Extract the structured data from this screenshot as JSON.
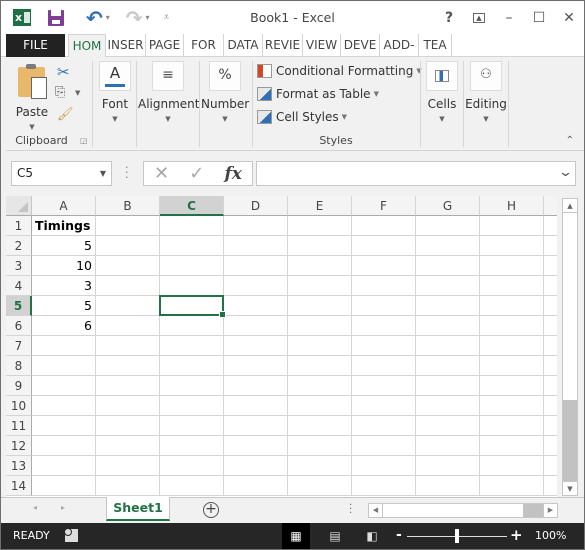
{
  "app": {
    "title": "Book1 - Excel",
    "help_label": "?",
    "minimize_label": "–",
    "maximize_label": "☐",
    "close_label": "✕"
  },
  "qat": {
    "excel_logo": "x",
    "undo_icon": "↶",
    "redo_icon": "↷",
    "dropdown_glyph": "▾",
    "customize_glyph": "⩡"
  },
  "tabs": [
    {
      "label": "FILE"
    },
    {
      "label": "HOM"
    },
    {
      "label": "INSER"
    },
    {
      "label": "PAGE"
    },
    {
      "label": "FOR"
    },
    {
      "label": "DATA"
    },
    {
      "label": "REVIE"
    },
    {
      "label": "VIEW"
    },
    {
      "label": "DEVE"
    },
    {
      "label": "ADD-"
    },
    {
      "label": "TEA"
    }
  ],
  "active_tab": "HOM",
  "ribbon": {
    "clipboard": {
      "paste_label": "Paste",
      "group_label": "Clipboard",
      "cut_icon": "✂",
      "copy_icon": "⎘",
      "format_painter_icon": "🖌"
    },
    "font": {
      "label": "Font",
      "icon": "A"
    },
    "alignment": {
      "label": "Alignment",
      "icon": "≡"
    },
    "number": {
      "label": "Number",
      "icon": "%"
    },
    "styles": {
      "conditional_formatting": "Conditional Formatting",
      "format_as_table": "Format as Table",
      "cell_styles": "Cell Styles",
      "group_label": "Styles"
    },
    "cells": {
      "label": "Cells"
    },
    "editing": {
      "label": "Editing"
    },
    "collapse_icon": "⌃"
  },
  "formula_bar": {
    "name_box": "C5",
    "cancel_icon": "✕",
    "enter_icon": "✓",
    "fx_label": "fx",
    "formula_value": "",
    "expand_icon": "⌄"
  },
  "sheet": {
    "columns": [
      "A",
      "B",
      "C",
      "D",
      "E",
      "F",
      "G",
      "H"
    ],
    "rows": [
      "1",
      "2",
      "3",
      "4",
      "5",
      "6",
      "7",
      "8",
      "9",
      "10",
      "11",
      "12",
      "13",
      "14"
    ],
    "selected_cell": "C5",
    "selected_column": "C",
    "selected_row": "5",
    "cells": {
      "A1": "Timings",
      "A2": "5",
      "A3": "10",
      "A4": "3",
      "A5": "5",
      "A6": "6"
    }
  },
  "sheet_tabs": {
    "tabs": [
      {
        "label": "Sheet1",
        "active": true
      }
    ],
    "add_sheet_label": "+",
    "prev_icon": "◂",
    "next_icon": "▸"
  },
  "status_bar": {
    "mode": "READY",
    "zoom_level": "100%",
    "zoom_percent": 100,
    "minus": "-",
    "plus": "+"
  }
}
